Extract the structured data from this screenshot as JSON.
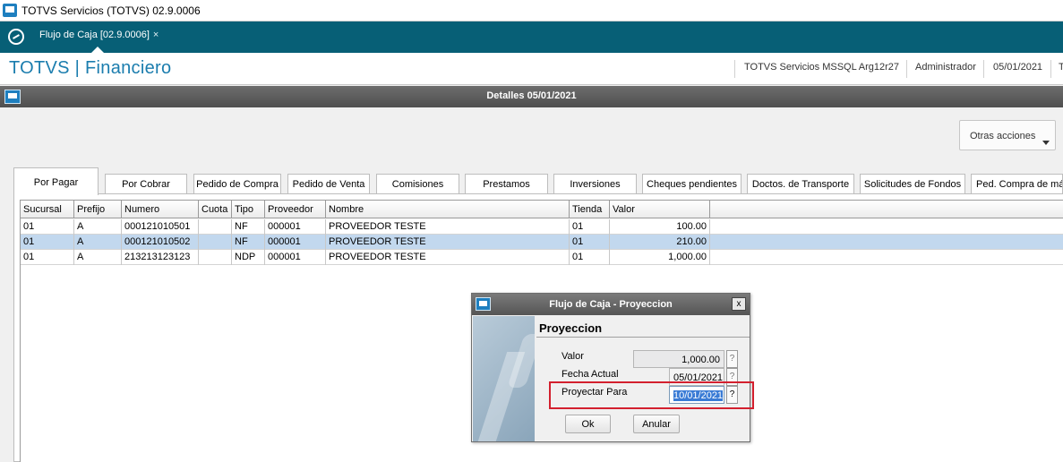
{
  "window": {
    "title": "TOTVS Servicios (TOTVS) 02.9.0006",
    "tab_label": "Flujo de Caja [02.9.0006]",
    "tab_close": "×"
  },
  "header": {
    "brand": "TOTVS | Financiero",
    "server": "TOTVS Servicios MSSQL Arg12r27",
    "user": "Administrador",
    "date": "05/01/2021",
    "overflow": "T"
  },
  "panel": {
    "title": "Detalles 05/01/2021"
  },
  "toolbar": {
    "otras_acciones": "Otras acciones"
  },
  "tabs": [
    {
      "label": "Por Pagar"
    },
    {
      "label": "Por Cobrar"
    },
    {
      "label": "Pedido de Compra"
    },
    {
      "label": "Pedido de Venta"
    },
    {
      "label": "Comisiones"
    },
    {
      "label": "Prestamos"
    },
    {
      "label": "Inversiones"
    },
    {
      "label": "Cheques pendientes"
    },
    {
      "label": "Doctos. de Transporte"
    },
    {
      "label": "Solicitudes de Fondos"
    },
    {
      "label": "Ped. Compra de máq"
    }
  ],
  "grid": {
    "columns": [
      "Sucursal",
      "Prefijo",
      "Numero",
      "Cuota",
      "Tipo",
      "Proveedor",
      "Nombre",
      "Tienda",
      "Valor"
    ],
    "rows": [
      [
        "01",
        "A",
        "000121010501",
        "",
        "NF",
        "000001",
        "PROVEEDOR TESTE",
        "01",
        "100.00"
      ],
      [
        "01",
        "A",
        "000121010502",
        "",
        "NF",
        "000001",
        "PROVEEDOR TESTE",
        "01",
        "210.00"
      ],
      [
        "01",
        "A",
        "213213123123",
        "",
        "NDP",
        "000001",
        "PROVEEDOR TESTE",
        "01",
        "1,000.00"
      ]
    ]
  },
  "dialog": {
    "title": "Flujo de Caja - Proyeccion",
    "close": "x",
    "section_title": "Proyeccion",
    "valor_label": "Valor",
    "valor_value": "1,000.00",
    "fecha_label": "Fecha Actual",
    "fecha_value": "05/01/2021",
    "proyectar_label": "Proyectar Para",
    "proyectar_value": "10/01/2021",
    "help": "?",
    "ok": "Ok",
    "anular": "Anular"
  },
  "colors": {
    "tabbar": "#075f76",
    "brand": "#1b7dae",
    "selection": "#c2d8ee",
    "highlight": "#d3202e"
  }
}
